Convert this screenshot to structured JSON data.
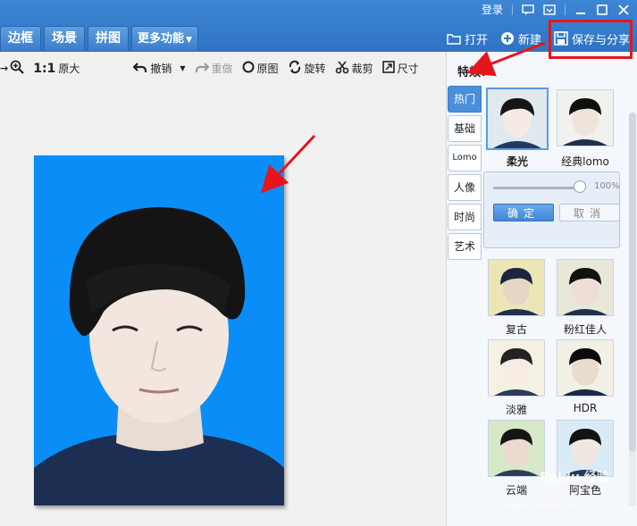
{
  "window": {
    "login": "登录"
  },
  "tabs": [
    "边框",
    "场景",
    "拼图",
    "更多功能"
  ],
  "actions": {
    "open": "打开",
    "new": "新建",
    "save_share": "保存与分享"
  },
  "toolbar": {
    "zoom_ratio": "1:1",
    "original_size": "原大",
    "undo": "撤销",
    "redo": "重做",
    "original_image": "原图",
    "rotate": "旋转",
    "crop": "裁剪",
    "size": "尺寸"
  },
  "panel": {
    "title": "特效：",
    "categories": [
      "热门",
      "基础",
      "Lomo",
      "人像",
      "时尚",
      "艺术"
    ],
    "effects": [
      "柔光",
      "经典lomo",
      "复古",
      "粉红佳人",
      "淡雅",
      "HDR",
      "云端",
      "阿宝色"
    ],
    "slider_value": "100%",
    "confirm": "确定",
    "cancel": "取消"
  },
  "watermark": {
    "main": "Baidu 经验",
    "sub": "jingyan.baidu.com"
  },
  "colors": {
    "accent": "#2f74c4",
    "highlight": "#e8141b",
    "photo_bg": "#0a8df6"
  }
}
